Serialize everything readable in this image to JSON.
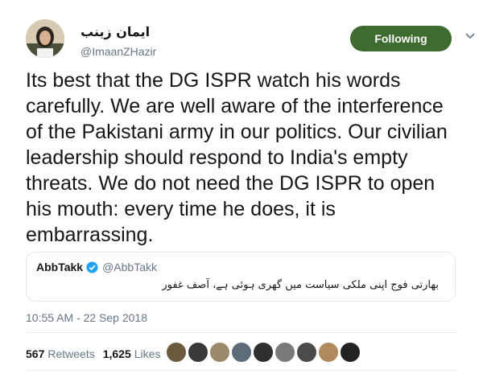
{
  "author": {
    "name": "ايمان زينب",
    "handle": "@ImaanZHazir"
  },
  "follow_button": {
    "label": "Following"
  },
  "tweet": {
    "text": "Its best that the DG ISPR watch his words carefully. We are well aware of the interference of the Pakistani army in our politics. Our civilian leadership should respond to India's empty threats. We do not need the DG ISPR to open his mouth: every time he does, it is embarrassing."
  },
  "quoted": {
    "name": "AbbTakk",
    "handle": "@AbbTakk",
    "text": "بھارتی فوج اپنی ملکی سیاست میں گھری ہوئی ہے، آصف غفور"
  },
  "timestamp": "10:55 AM - 22 Sep 2018",
  "stats": {
    "retweets_count": "567",
    "retweets_label": "Retweets",
    "likes_count": "1,625",
    "likes_label": "Likes"
  },
  "likers": [
    {
      "color": "#6b5a3e",
      "icon": "avatar"
    },
    {
      "color": "#3a3a3a",
      "icon": "avatar"
    },
    {
      "color": "#9a8a6a",
      "icon": "avatar"
    },
    {
      "color": "#5a6b7a",
      "icon": "avatar"
    },
    {
      "color": "#2f2f2f",
      "icon": "avatar"
    },
    {
      "color": "#7a7a7a",
      "icon": "avatar"
    },
    {
      "color": "#4a4a4a",
      "icon": "avatar"
    },
    {
      "color": "#b08a5a",
      "icon": "avatar"
    },
    {
      "color": "#222222",
      "icon": "avatar"
    }
  ],
  "colors": {
    "follow_button_bg": "#3e6b2f",
    "verified": "#1da1f2",
    "secondary_text": "#657786"
  }
}
